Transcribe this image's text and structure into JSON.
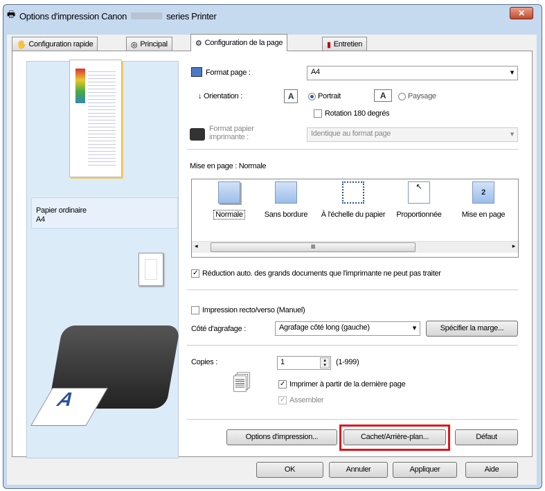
{
  "window": {
    "title_prefix": "Options d'impression Canon",
    "title_suffix": "series Printer",
    "close": "✕"
  },
  "tabs": [
    {
      "label": "Configuration rapide"
    },
    {
      "label": "Principal"
    },
    {
      "label": "Configuration de la page"
    },
    {
      "label": "Entretien"
    }
  ],
  "preview": {
    "paper_type": "Papier ordinaire",
    "paper_size": "A4"
  },
  "page_format": {
    "label": "Format page :",
    "value": "A4"
  },
  "orientation": {
    "label": "Orientation :",
    "portrait": "Portrait",
    "landscape": "Paysage",
    "selected": "Portrait",
    "rotate": "Rotation 180 degrés",
    "rotate_checked": false
  },
  "printer_paper": {
    "label": "Format papier imprimante :",
    "value": "Identique au format page"
  },
  "layout": {
    "label": "Mise en page :",
    "value": "Normale",
    "options": [
      "Normale",
      "Sans bordure",
      "À l'échelle du papier",
      "Proportionnée",
      "Mise en page"
    ],
    "scroll_mark": "III"
  },
  "auto_reduce": {
    "label": "Réduction auto. des grands documents que l'imprimante ne peut pas traiter",
    "checked": true
  },
  "duplex": {
    "label": "Impression recto/verso (Manuel)",
    "checked": false
  },
  "staple": {
    "label": "Côté d'agrafage :",
    "value": "Agrafage côté long (gauche)",
    "margin_button": "Spécifier la marge..."
  },
  "copies": {
    "label": "Copies :",
    "value": "1",
    "range": "(1-999)",
    "last_page": "Imprimer à partir de la dernière page",
    "last_page_checked": true,
    "collate": "Assembler",
    "collate_checked": true
  },
  "buttons": {
    "print_options": "Options d'impression...",
    "stamp": "Cachet/Arrière-plan...",
    "default": "Défaut",
    "ok": "OK",
    "cancel": "Annuler",
    "apply": "Appliquer",
    "help": "Aide"
  },
  "highlight_color": "#e0141e"
}
